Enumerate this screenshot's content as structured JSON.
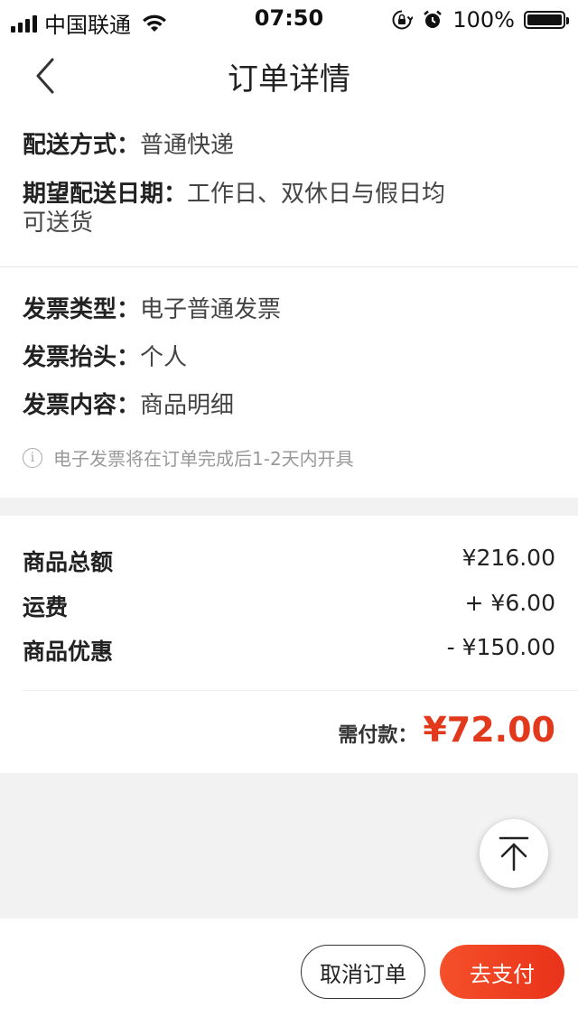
{
  "status_bar": {
    "carrier": "中国联通",
    "time": "07:50",
    "battery_text": "100%",
    "icons": [
      "signal-icon",
      "wifi-icon",
      "rotation-lock-icon",
      "alarm-icon",
      "battery-icon"
    ]
  },
  "nav": {
    "title": "订单详情",
    "back_icon": "chevron-left-icon"
  },
  "delivery": {
    "method_label": "配送方式：",
    "method_value": "普通快递",
    "date_label": "期望配送日期：",
    "date_value_line1": "工作日、双休日与假日均",
    "date_value_line2": "可送货"
  },
  "invoice": {
    "type_label": "发票类型：",
    "type_value": "电子普通发票",
    "title_label": "发票抬头：",
    "title_value": "个人",
    "content_label": "发票内容：",
    "content_value": "商品明细",
    "notice": "电子发票将在订单完成后1-2天内开具",
    "notice_icon": "info-icon"
  },
  "amounts": {
    "items": [
      {
        "label": "商品总额",
        "value": "¥216.00"
      },
      {
        "label": "运费",
        "value": "+ ¥6.00"
      },
      {
        "label": "商品优惠",
        "value": "- ¥150.00"
      }
    ],
    "total_label": "需付款：",
    "total_value": "¥72.00"
  },
  "actions": {
    "cancel_label": "取消订单",
    "pay_label": "去支付",
    "scroll_top_icon": "arrow-up-to-top-icon"
  },
  "colors": {
    "accent": "#e2381c",
    "pay_button": "#f0401f",
    "background": "#f2f2f2"
  }
}
